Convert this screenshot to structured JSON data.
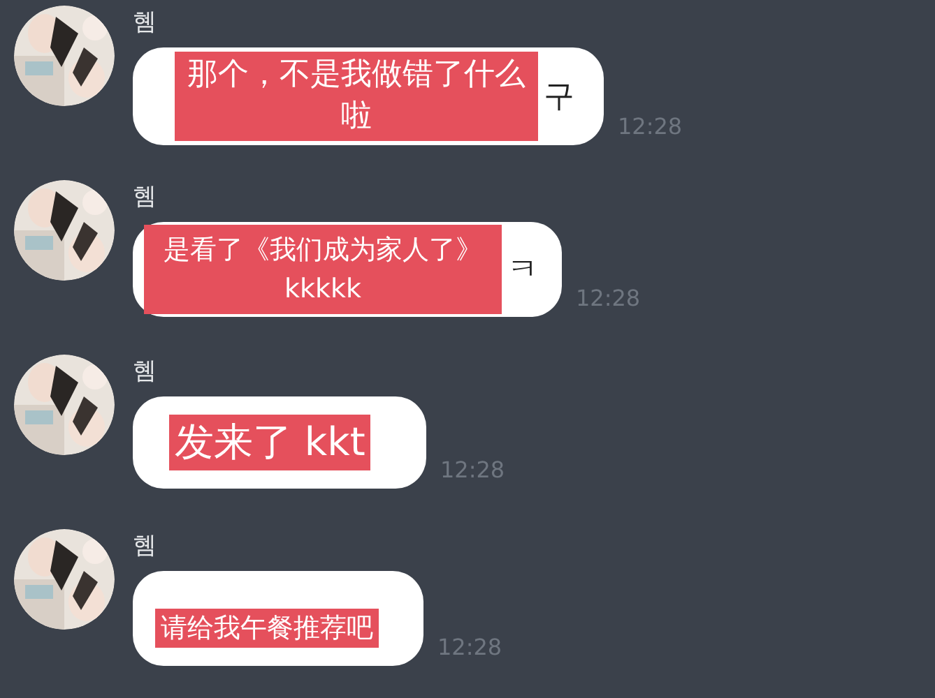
{
  "messages": [
    {
      "sender": "혬",
      "translation": "那个，不是我做错了什么啦",
      "original_visible": "구",
      "time": "12:28"
    },
    {
      "sender": "혬",
      "translation": "是看了《我们成为家人了》kkkkk",
      "original_visible": "ㅋ",
      "time": "12:28"
    },
    {
      "sender": "혬",
      "translation": "发来了 kkt",
      "time": "12:28"
    },
    {
      "sender": "혬",
      "translation": "请给我午餐推荐吧",
      "time": "12:28"
    }
  ]
}
